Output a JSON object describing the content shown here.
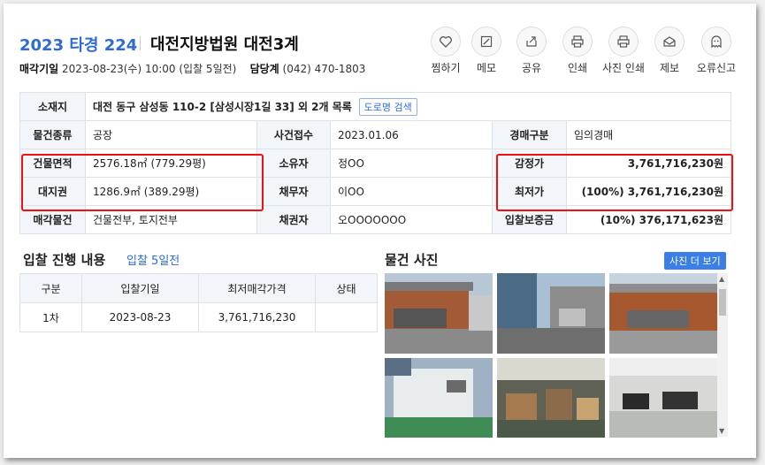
{
  "header": {
    "case_no": "2023 타경 224",
    "court": "대전지방법원 대전3계",
    "auction_date_label": "매각기일",
    "auction_date_value": "2023-08-23(수) 10:00 (입찰 5일전)",
    "contact_label": "담당계",
    "contact_value": "(042) 470-1803"
  },
  "actions": [
    "찜하기",
    "메모",
    "공유",
    "인쇄",
    "사진 인쇄",
    "제보",
    "오류신고"
  ],
  "info": {
    "location_label": "소재지",
    "location_value": "대전 동구 삼성동 110-2 [삼성시장1길 33] 외 2개 목록",
    "road_search": "도로명 검색",
    "type_label": "물건종류",
    "type_value": "공장",
    "receipt_label": "사건접수",
    "receipt_value": "2023.01.06",
    "kind_label": "경매구분",
    "kind_value": "임의경매",
    "bldg_label": "건물면적",
    "bldg_value": "2576.18㎡ (779.29평)",
    "owner_label": "소유자",
    "owner_value": "정OO",
    "appraisal_label": "감정가",
    "appraisal_value": "3,761,716,230원",
    "land_label": "대지권",
    "land_value": "1286.9㎡ (389.29평)",
    "debtor_label": "채무자",
    "debtor_value": "이OO",
    "min_label": "최저가",
    "min_value": "(100%) 3,761,716,230원",
    "object_label": "매각물건",
    "object_value": "건물전부, 토지전부",
    "creditor_label": "채권자",
    "creditor_value": "오OOOOOOO",
    "deposit_label": "입찰보증금",
    "deposit_value": "(10%) 376,171,623원"
  },
  "bid_section": {
    "title": "입찰 진행 내용",
    "sub": "입찰 5일전",
    "headers": [
      "구분",
      "입찰기일",
      "최저매각가격",
      "상태"
    ],
    "row": [
      "1차",
      "2023-08-23",
      "3,761,716,230",
      ""
    ]
  },
  "photo_section": {
    "title": "물건 사진",
    "more": "사진 더 보기"
  },
  "colors": {
    "accent": "#2d6bd6",
    "highlight_box": "#e11111"
  }
}
